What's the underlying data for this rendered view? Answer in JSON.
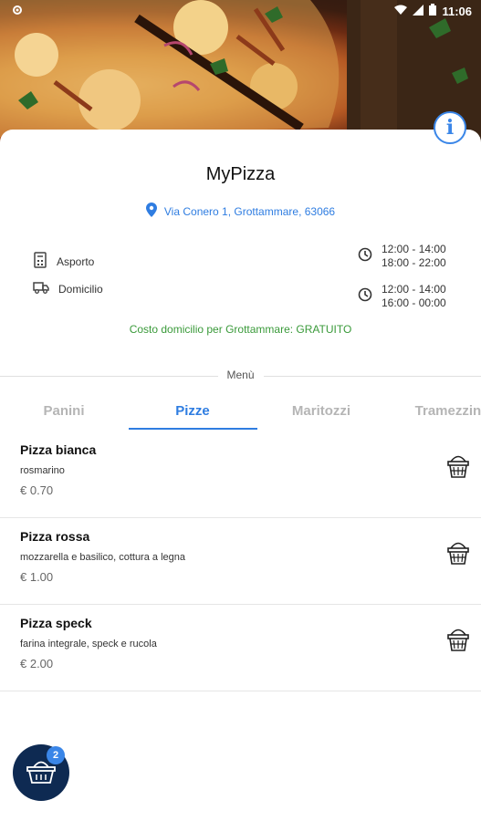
{
  "status_bar": {
    "time": "11:06"
  },
  "restaurant": {
    "name": "MyPizza",
    "address": "Via Conero 1, Grottammare, 63066"
  },
  "services": [
    {
      "label": "Asporto",
      "icon": "takeaway-box-icon"
    },
    {
      "label": "Domicilio",
      "icon": "delivery-truck-icon"
    }
  ],
  "hours": [
    {
      "times": [
        "12:00 - 14:00",
        "18:00 - 22:00"
      ],
      "icon": "clock-icon"
    },
    {
      "times": [
        "12:00 - 14:00",
        "16:00 - 00:00"
      ],
      "icon": "clock-icon"
    }
  ],
  "delivery_note": "Costo domicilio per Grottammare: GRATUITO",
  "menu_label": "Menù",
  "tabs": [
    {
      "label": "Panini"
    },
    {
      "label": "Pizze",
      "active": true
    },
    {
      "label": "Maritozzi"
    },
    {
      "label": "Tramezzini"
    }
  ],
  "items": [
    {
      "name": "Pizza bianca",
      "description": "rosmarino",
      "price": "€ 0.70"
    },
    {
      "name": "Pizza rossa",
      "description": "mozzarella e basilico, cottura a legna",
      "price": "€ 1.00"
    },
    {
      "name": "Pizza speck",
      "description": "farina integrale, speck e rucola",
      "price": "€ 2.00"
    }
  ],
  "cart": {
    "count": "2"
  },
  "colors": {
    "accent": "#2f7de1",
    "success": "#3a9a3a",
    "fab": "#0e2a52"
  }
}
